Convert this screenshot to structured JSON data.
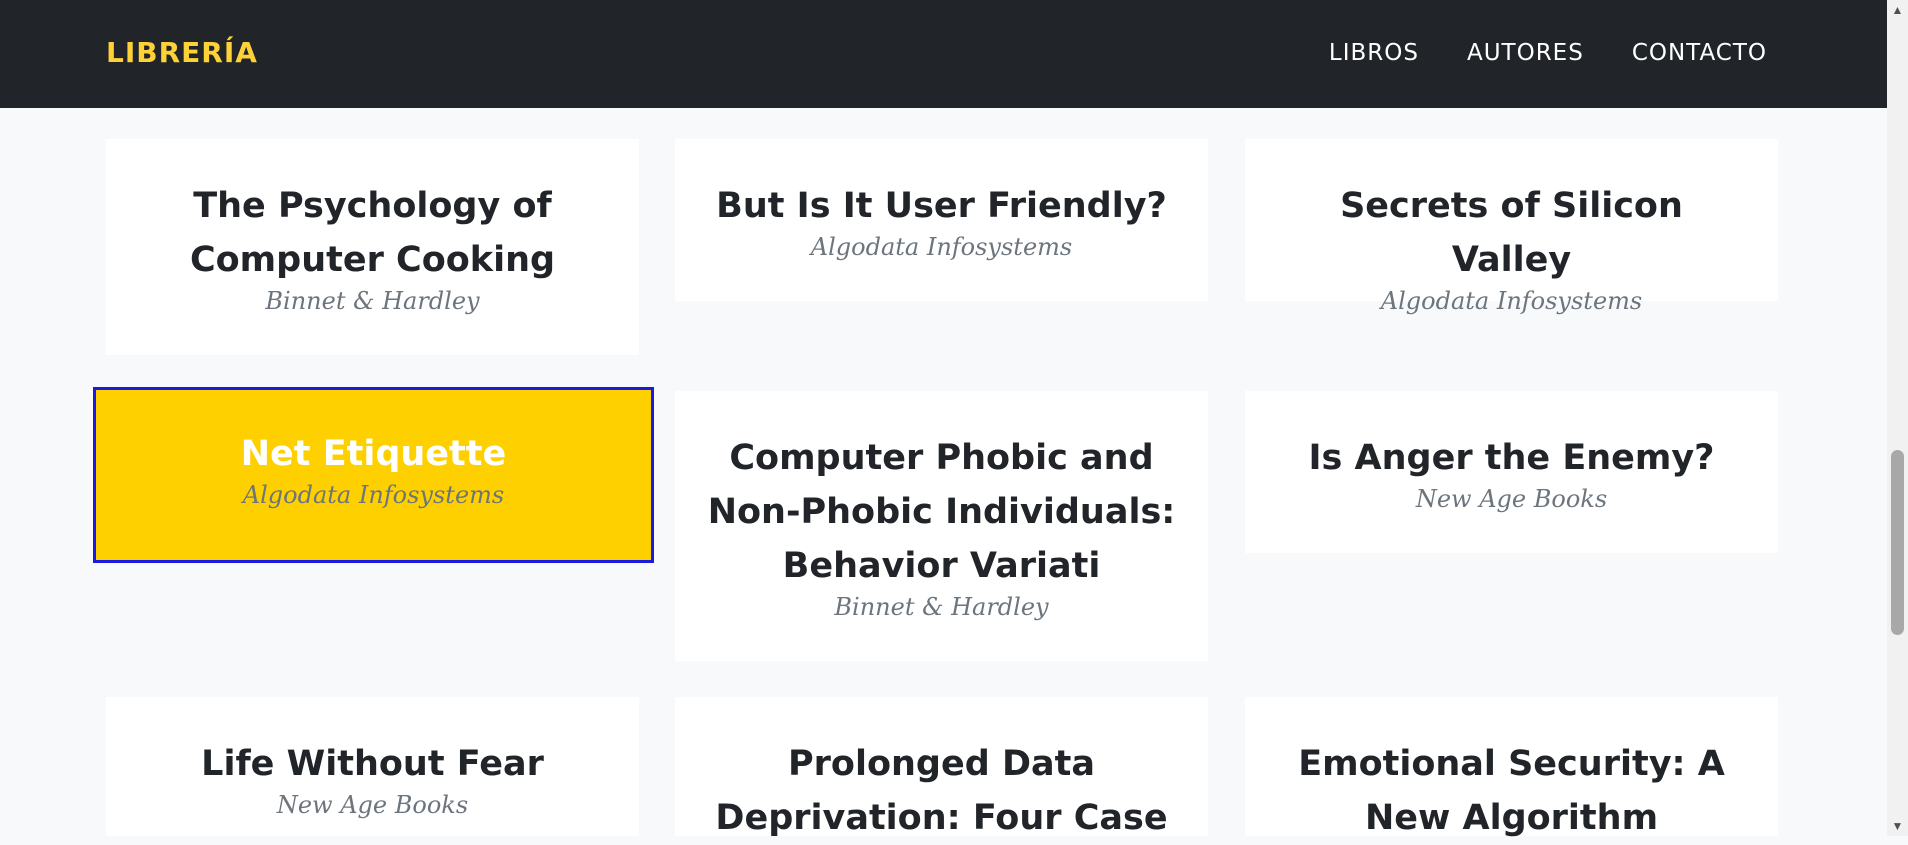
{
  "nav": {
    "brand": "LIBRERÍA",
    "links": [
      "LIBROS",
      "AUTORES",
      "CONTACTO"
    ]
  },
  "books": [
    {
      "title": "The Psychology of Computer Cooking",
      "publisher": "Binnet & Hardley"
    },
    {
      "title": "But Is It User Friendly?",
      "publisher": "Algodata Infosystems"
    },
    {
      "title": "Secrets of Silicon Valley",
      "publisher": "Algodata Infosystems"
    },
    {
      "title": "Net Etiquette",
      "publisher": "Algodata Infosystems"
    },
    {
      "title": "Computer Phobic and Non-Phobic Individuals: Behavior Variati",
      "publisher": "Binnet & Hardley"
    },
    {
      "title": "Is Anger the Enemy?",
      "publisher": "New Age Books"
    },
    {
      "title": "Life Without Fear",
      "publisher": "New Age Books"
    },
    {
      "title": "Prolonged Data Deprivation: Four Case",
      "publisher": ""
    },
    {
      "title": "Emotional Security: A New Algorithm",
      "publisher": ""
    }
  ],
  "colors": {
    "navbar": "#212529",
    "brand": "#fed136",
    "active_card": "#fed000",
    "active_border": "#1a1ae0"
  },
  "icons": {
    "scroll_up": "scroll-up-arrow-icon",
    "scroll_down": "scroll-down-arrow-icon"
  }
}
